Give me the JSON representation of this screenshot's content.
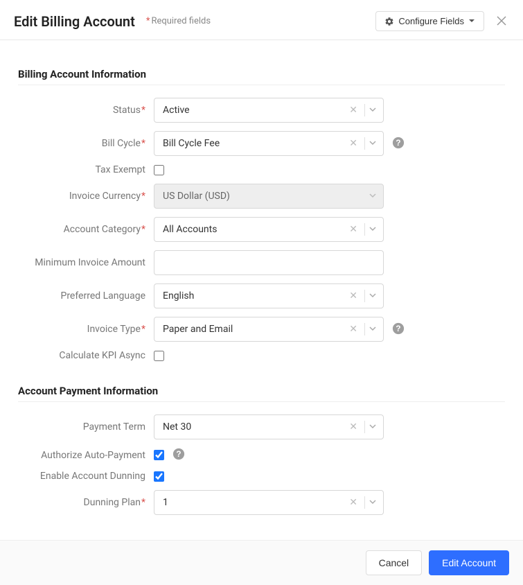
{
  "header": {
    "title": "Edit Billing Account",
    "required_note": "Required fields",
    "configure_label": "Configure Fields"
  },
  "sections": {
    "billing_info_title": "Billing Account Information",
    "payment_info_title": "Account Payment Information"
  },
  "labels": {
    "status": "Status",
    "bill_cycle": "Bill Cycle",
    "tax_exempt": "Tax Exempt",
    "invoice_currency": "Invoice Currency",
    "account_category": "Account Category",
    "min_invoice_amount": "Minimum Invoice Amount",
    "preferred_language": "Preferred Language",
    "invoice_type": "Invoice Type",
    "calc_kpi_async": "Calculate KPI Async",
    "payment_term": "Payment Term",
    "authorize_auto_payment": "Authorize Auto-Payment",
    "enable_dunning": "Enable Account Dunning",
    "dunning_plan": "Dunning Plan"
  },
  "values": {
    "status": "Active",
    "bill_cycle": "Bill Cycle Fee",
    "invoice_currency": "US Dollar (USD)",
    "account_category": "All Accounts",
    "min_invoice_amount": "",
    "preferred_language": "English",
    "invoice_type": "Paper and Email",
    "payment_term": "Net 30",
    "dunning_plan": "1",
    "tax_exempt_checked": false,
    "calc_kpi_async_checked": false,
    "authorize_auto_payment_checked": true,
    "enable_dunning_checked": true
  },
  "footer": {
    "cancel": "Cancel",
    "submit": "Edit Account"
  }
}
